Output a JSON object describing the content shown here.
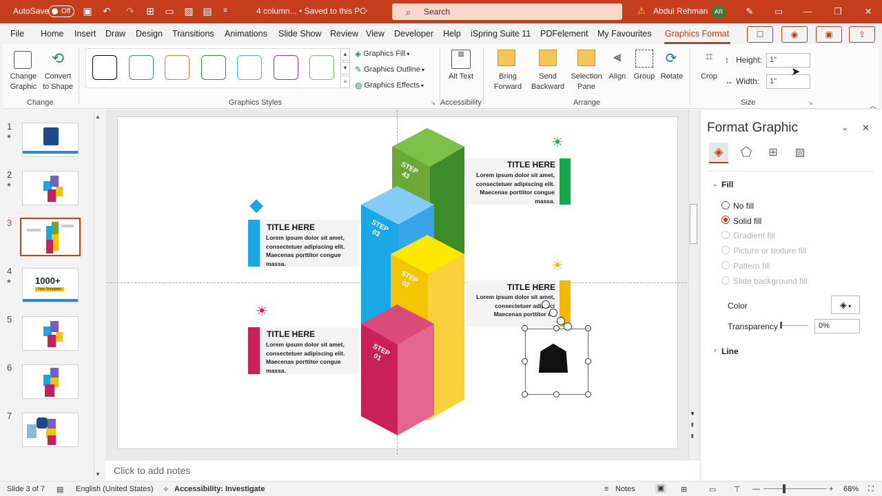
{
  "titlebar": {
    "autosave_label": "AutoSave",
    "autosave_state": "Off",
    "doc_title": "4 column...  •  Saved to this PC",
    "search_placeholder": "Search",
    "user_name": "Abdul Rehman",
    "user_initials": "AR",
    "accent": "#c43e1c"
  },
  "tabs": [
    "File",
    "Home",
    "Insert",
    "Draw",
    "Design",
    "Transitions",
    "Animations",
    "Slide Show",
    "Review",
    "View",
    "Developer",
    "Help",
    "iSpring Suite 11",
    "PDFelement",
    "My Favourites",
    "Graphics Format"
  ],
  "active_tab": "Graphics Format",
  "ribbon": {
    "change": {
      "change_graphic": "Change Graphic",
      "convert": "Convert to Shape",
      "group": "Change"
    },
    "styles": {
      "group": "Graphics Styles",
      "fill": "Graphics Fill",
      "outline": "Graphics Outline",
      "effects": "Graphics Effects",
      "swatch_colors": [
        "#000000",
        "#3b86b8",
        "#e07b39",
        "#3a8a3a",
        "#42b7d6",
        "#9a3aa8",
        "#79c06a"
      ]
    },
    "accessibility": {
      "alt_text": "Alt Text",
      "group": "Accessibility"
    },
    "arrange": {
      "bring_forward": "Bring Forward",
      "send_backward": "Send Backward",
      "selection_pane": "Selection Pane",
      "align": "Align",
      "group_btn": "Group",
      "rotate": "Rotate",
      "group": "Arrange"
    },
    "size": {
      "crop": "Crop",
      "height_label": "Height:",
      "height_value": "1\"",
      "width_label": "Width:",
      "width_value": "1\"",
      "group": "Size"
    }
  },
  "slides": [
    {
      "num": "1",
      "star": "★"
    },
    {
      "num": "2",
      "star": "★"
    },
    {
      "num": "3",
      "star": ""
    },
    {
      "num": "4",
      "star": "★"
    },
    {
      "num": "5",
      "star": ""
    },
    {
      "num": "6",
      "star": ""
    },
    {
      "num": "7",
      "star": ""
    }
  ],
  "thumb4_text": "1000+",
  "thumb4_sub": "Free Templates",
  "slide": {
    "blocks": [
      {
        "title": "TITLE HERE",
        "body": "Lorem ipsum dolor sit amet,\nconsectetuer adipiscing elit.\nMaecenas porttitor congue\nmassa.",
        "color": "#1ba8e0"
      },
      {
        "title": "TITLE HERE",
        "body": "Lorem ipsum dolor sit amet,\nconsectetuer adipiscing elit.\nMaecenas porttitor congue\nmassa.",
        "color": "#c8215a"
      },
      {
        "title": "TITLE HERE",
        "body": "Lorem ipsum dolor sit amet,\nconsectetuer adipiscing elit.\nMaecenas porttitor congue\nmassa.",
        "color": "#18a84a"
      },
      {
        "title": "TITLE HERE",
        "body": "Lorem ipsum dolor sit amet,\nconsectetuer adipisci\nMaecenas porttitor co",
        "color": "#f5b800"
      }
    ],
    "steps": [
      {
        "label": "STEP\n01",
        "front": "#c8215a",
        "side": "#e2668f",
        "top": "#d84b7a"
      },
      {
        "label": "STEP\n02",
        "front": "#f5c400",
        "side": "#fbd13e",
        "top": "#ffe800"
      },
      {
        "label": "STEP\n03",
        "front": "#18a8e6",
        "side": "#3aa3e8",
        "top": "#85cbf5"
      },
      {
        "label": "STEP\n43",
        "front": "#6ba836",
        "side": "#3c8d2a",
        "top": "#7cc24a"
      }
    ]
  },
  "notes_placeholder": "Click to add notes",
  "format_pane": {
    "title": "Format Graphic",
    "fill_section": "Fill",
    "options": [
      {
        "label": "No fill",
        "state": "off"
      },
      {
        "label": "Solid fill",
        "state": "on"
      },
      {
        "label": "Gradient fill",
        "state": "disabled"
      },
      {
        "label": "Picture or texture fill",
        "state": "disabled"
      },
      {
        "label": "Pattern fill",
        "state": "disabled"
      },
      {
        "label": "Slide background fill",
        "state": "disabled"
      }
    ],
    "color_label": "Color",
    "transparency_label": "Transparency",
    "transparency_value": "0%",
    "line_section": "Line"
  },
  "status": {
    "slide_info": "Slide 3 of 7",
    "language": "English (United States)",
    "accessibility": "Accessibility: Investigate",
    "notes": "Notes",
    "zoom": "68%"
  }
}
